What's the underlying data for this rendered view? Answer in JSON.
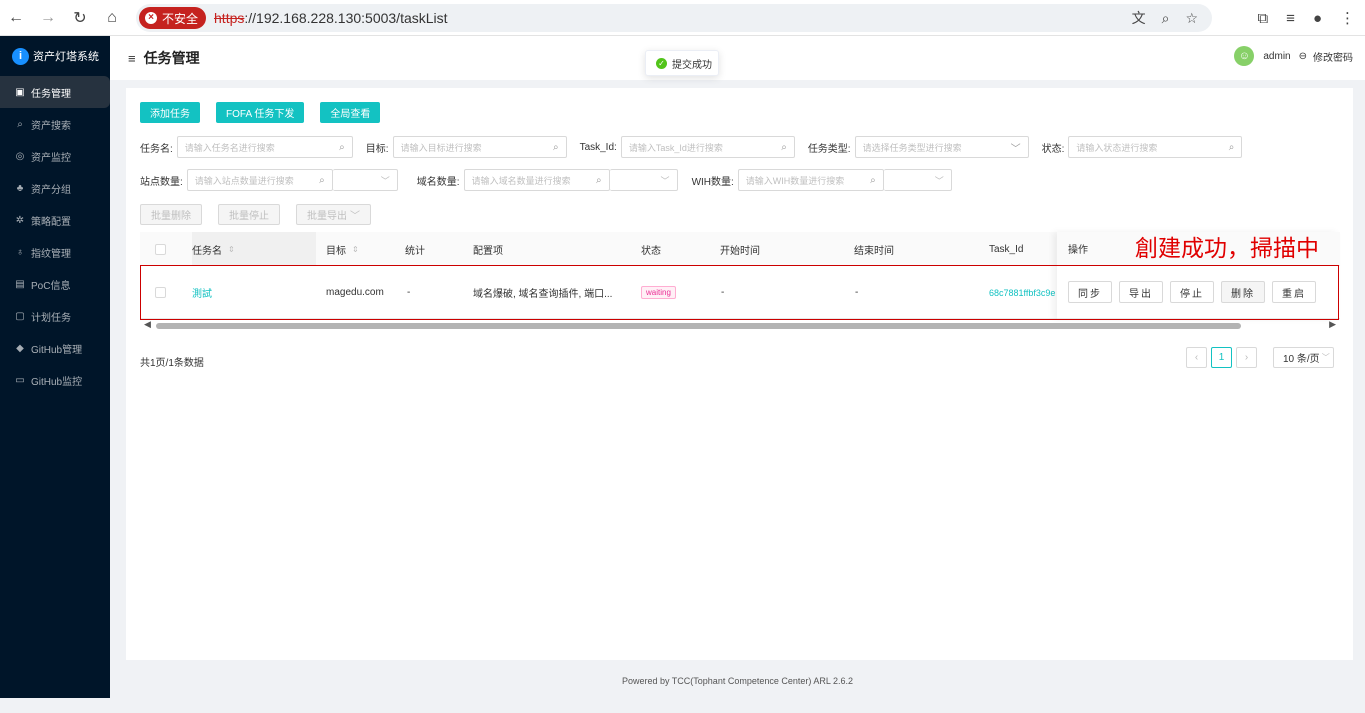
{
  "browser": {
    "insecure_label": "不安全",
    "url_scheme": "https",
    "url_rest": "://192.168.228.130:5003/taskList"
  },
  "sidebar": {
    "app_name": "资产灯塔系统",
    "items": [
      {
        "label": "任务管理",
        "icon": "calendar-icon"
      },
      {
        "label": "资产搜索",
        "icon": "search-icon"
      },
      {
        "label": "资产监控",
        "icon": "target-icon"
      },
      {
        "label": "资产分组",
        "icon": "group-icon"
      },
      {
        "label": "策略配置",
        "icon": "gear-icon"
      },
      {
        "label": "指纹管理",
        "icon": "fingerprint-icon"
      },
      {
        "label": "PoC信息",
        "icon": "file-icon"
      },
      {
        "label": "计划任务",
        "icon": "schedule-icon"
      },
      {
        "label": "GitHub管理",
        "icon": "github-icon"
      },
      {
        "label": "GitHub监控",
        "icon": "monitor-icon"
      }
    ]
  },
  "header": {
    "title": "任务管理",
    "user": "admin",
    "change_password": "修改密码"
  },
  "toast": {
    "text": "提交成功"
  },
  "toolbar": {
    "add_task": "添加任务",
    "fofa_task": "FOFA 任务下发",
    "global_view": "全局查看"
  },
  "filters": {
    "task_name_label": "任务名:",
    "task_name_ph": "请输入任务名进行搜索",
    "target_label": "目标:",
    "target_ph": "请输入目标进行搜索",
    "task_id_label": "Task_Id:",
    "task_id_ph": "请输入Task_Id进行搜索",
    "task_type_label": "任务类型:",
    "task_type_ph": "请选择任务类型进行搜索",
    "status_label": "状态:",
    "status_ph": "请输入状态进行搜索",
    "site_count_label": "站点数量:",
    "site_count_ph": "请输入站点数量进行搜索",
    "domain_count_label": "域名数量:",
    "domain_count_ph": "请输入域名数量进行搜索",
    "wih_count_label": "WIH数量:",
    "wih_count_ph": "请输入WIH数量进行搜索"
  },
  "batch": {
    "delete": "批量删除",
    "stop": "批量停止",
    "export": "批量导出"
  },
  "table": {
    "headers": {
      "name": "任务名",
      "target": "目标",
      "stats": "统计",
      "config": "配置项",
      "status": "状态",
      "start": "开始时间",
      "end": "结束时间",
      "task_id": "Task_Id",
      "ops": "操作"
    },
    "rows": [
      {
        "name": "測試",
        "target": "magedu.com",
        "stats": "-",
        "config": "域名爆破, 域名查询插件, 端口...",
        "status": "waiting",
        "start": "-",
        "end": "-",
        "task_id": "68c7881ffbf3c9e"
      }
    ],
    "actions": {
      "sync": "同步",
      "export": "导出",
      "stop": "停止",
      "delete": "删除",
      "restart": "重启"
    }
  },
  "pagination": {
    "total_text": "共1页/1条数据",
    "current": "1",
    "page_size": "10 条/页"
  },
  "footer": "Powered by TCC(Tophant Competence Center) ARL 2.6.2",
  "annotation": "創建成功，掃描中",
  "colors": {
    "accent": "#13c2c2",
    "sidebar": "#001529",
    "status_tag": "#eb2f96",
    "annotation": "#e00000"
  }
}
